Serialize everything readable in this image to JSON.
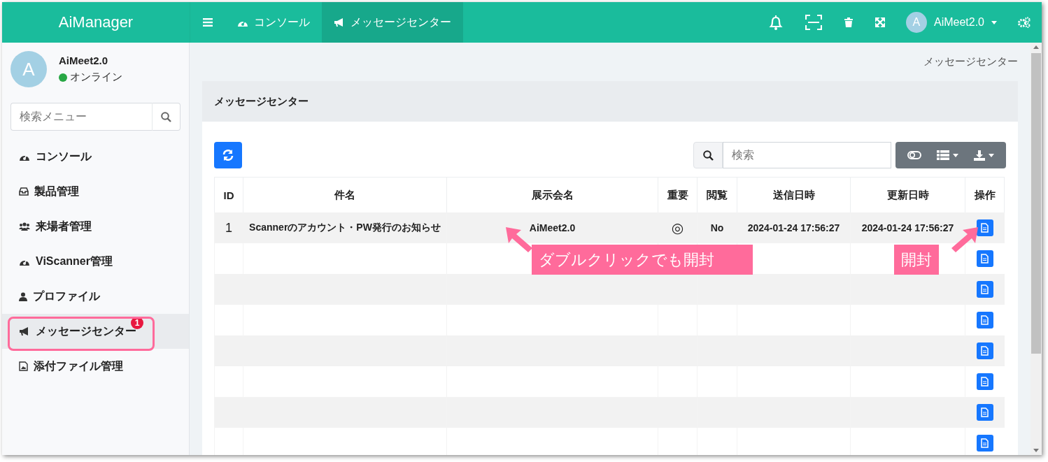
{
  "app": {
    "brand": "AiManager"
  },
  "topnav": [
    {
      "label": "コンソール",
      "selected": false
    },
    {
      "label": "メッセージセンター",
      "selected": true
    }
  ],
  "user_menu": {
    "avatar": "A",
    "name": "AiMeet2.0"
  },
  "sidebar": {
    "user": {
      "avatar": "A",
      "name": "AiMeet2.0",
      "status": "オンライン"
    },
    "search": {
      "placeholder": "検索メニュー"
    },
    "items": [
      {
        "label": "コンソール",
        "selected": false
      },
      {
        "label": "製品管理",
        "selected": false
      },
      {
        "label": "来場者管理",
        "selected": false
      },
      {
        "label": "ViScanner管理",
        "selected": false
      },
      {
        "label": "プロファイル",
        "selected": false
      },
      {
        "label": "メッセージセンター",
        "selected": true,
        "badge": "1"
      },
      {
        "label": "添付ファイル管理",
        "selected": false
      }
    ]
  },
  "breadcrumb": "メッセージセンター",
  "card": {
    "title": "メッセージセンター",
    "search": {
      "placeholder": "検索"
    },
    "table": {
      "columns": [
        "ID",
        "件名",
        "展示会名",
        "重要",
        "閲覧",
        "送信日時",
        "更新日時",
        "操作"
      ],
      "rows": [
        {
          "kind": "message",
          "cells": [
            "1",
            "Scannerのアカウント・PW発行のお知らせ",
            "AiMeet2.0",
            "◎",
            "No",
            "2024-01-24 17:56:27",
            "2024-01-24 17:56:27"
          ]
        },
        {
          "kind": "empty"
        },
        {
          "kind": "empty"
        },
        {
          "kind": "empty"
        },
        {
          "kind": "empty"
        },
        {
          "kind": "empty"
        },
        {
          "kind": "empty"
        },
        {
          "kind": "empty"
        }
      ]
    }
  },
  "annotations": [
    "ダブルクリックでも開封",
    "開封"
  ]
}
